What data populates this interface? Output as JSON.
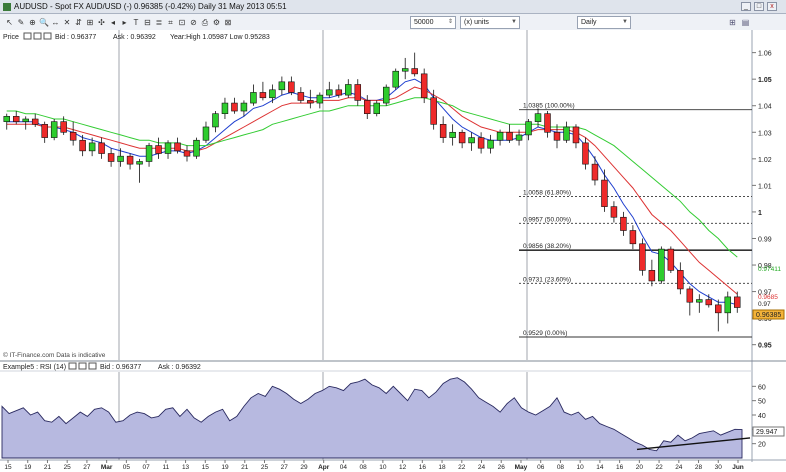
{
  "window": {
    "title": "AUDUSD - Spot FX AUD/USD (-)   0.96385 (-0.42%)   Daily   31 May 2013 05:51",
    "min_label": "_",
    "max_label": "□",
    "close_label": "x"
  },
  "toolbar": {
    "tools": [
      "↖",
      "✎",
      "⊕",
      "🔍",
      "↔",
      "✕",
      "⇵",
      "⊞",
      "✣",
      "◂",
      "▸",
      "T",
      "⊟",
      "≣",
      "⌗",
      "⊡",
      "⊘",
      "⎙",
      "⚙",
      "⊠"
    ],
    "units_value": "50000",
    "units_label": "(x) units",
    "period_value": "Daily"
  },
  "price_panel": {
    "header": "Price",
    "bid": "Bid : 0.96377",
    "ask": "Ask : 0.96392",
    "stats": "Year:High 1.05987 Low 0.95283",
    "source": "© IT-Finance.com   Data is indicative",
    "current_label": "0.96385",
    "ma_labels": [
      {
        "text": "0.97411",
        "color": "#22aa22"
      },
      {
        "text": "0.9685",
        "color": "#dd3333"
      },
      {
        "text": "0.97",
        "color": "#222222"
      }
    ]
  },
  "rsi_panel": {
    "header": "Example5 : RSI (14)",
    "bid": "Bid : 0.96377",
    "ask": "Ask : 0.96392",
    "current_label": "29.947"
  },
  "chart_data": {
    "type": "candlestick",
    "ylim": [
      0.948,
      1.064
    ],
    "y_ticks": [
      "1.06",
      "1.05",
      "1.04",
      "1.03",
      "1.02",
      "1.01",
      "1",
      "0.99",
      "0.98",
      "0.97",
      "0.96",
      "0.95"
    ],
    "y_tick_values": [
      1.06,
      1.05,
      1.04,
      1.03,
      1.02,
      1.01,
      1.0,
      0.99,
      0.98,
      0.97,
      0.96,
      0.95
    ],
    "x_ticks": [
      "15",
      "19",
      "21",
      "25",
      "27",
      "Mar",
      "05",
      "07",
      "11",
      "13",
      "15",
      "19",
      "21",
      "25",
      "27",
      "29",
      "Apr",
      "04",
      "08",
      "10",
      "12",
      "16",
      "18",
      "22",
      "24",
      "26",
      "May",
      "06",
      "08",
      "10",
      "14",
      "16",
      "20",
      "22",
      "24",
      "28",
      "30",
      "Jun"
    ],
    "candles": [
      [
        1.034,
        1.037,
        1.031,
        1.036
      ],
      [
        1.036,
        1.038,
        1.033,
        1.034
      ],
      [
        1.034,
        1.036,
        1.031,
        1.035
      ],
      [
        1.035,
        1.037,
        1.032,
        1.033
      ],
      [
        1.033,
        1.034,
        1.026,
        1.028
      ],
      [
        1.028,
        1.035,
        1.027,
        1.034
      ],
      [
        1.034,
        1.036,
        1.029,
        1.03
      ],
      [
        1.03,
        1.034,
        1.025,
        1.027
      ],
      [
        1.027,
        1.029,
        1.021,
        1.023
      ],
      [
        1.023,
        1.028,
        1.021,
        1.026
      ],
      [
        1.026,
        1.028,
        1.02,
        1.022
      ],
      [
        1.022,
        1.024,
        1.017,
        1.019
      ],
      [
        1.019,
        1.024,
        1.017,
        1.021
      ],
      [
        1.021,
        1.022,
        1.016,
        1.018
      ],
      [
        1.018,
        1.02,
        1.011,
        1.019
      ],
      [
        1.019,
        1.026,
        1.017,
        1.025
      ],
      [
        1.025,
        1.028,
        1.02,
        1.022
      ],
      [
        1.022,
        1.027,
        1.02,
        1.026
      ],
      [
        1.026,
        1.028,
        1.022,
        1.023
      ],
      [
        1.023,
        1.025,
        1.019,
        1.021
      ],
      [
        1.021,
        1.028,
        1.02,
        1.027
      ],
      [
        1.027,
        1.034,
        1.026,
        1.032
      ],
      [
        1.032,
        1.038,
        1.03,
        1.037
      ],
      [
        1.037,
        1.043,
        1.035,
        1.041
      ],
      [
        1.041,
        1.043,
        1.037,
        1.038
      ],
      [
        1.038,
        1.042,
        1.036,
        1.041
      ],
      [
        1.041,
        1.048,
        1.04,
        1.045
      ],
      [
        1.045,
        1.049,
        1.042,
        1.043
      ],
      [
        1.043,
        1.048,
        1.041,
        1.046
      ],
      [
        1.046,
        1.051,
        1.044,
        1.049
      ],
      [
        1.049,
        1.051,
        1.044,
        1.045
      ],
      [
        1.045,
        1.047,
        1.041,
        1.042
      ],
      [
        1.042,
        1.046,
        1.039,
        1.041
      ],
      [
        1.041,
        1.045,
        1.039,
        1.044
      ],
      [
        1.044,
        1.049,
        1.043,
        1.046
      ],
      [
        1.046,
        1.048,
        1.043,
        1.044
      ],
      [
        1.044,
        1.05,
        1.043,
        1.048
      ],
      [
        1.048,
        1.05,
        1.04,
        1.042
      ],
      [
        1.042,
        1.044,
        1.035,
        1.037
      ],
      [
        1.037,
        1.042,
        1.036,
        1.041
      ],
      [
        1.041,
        1.048,
        1.04,
        1.047
      ],
      [
        1.047,
        1.054,
        1.046,
        1.053
      ],
      [
        1.053,
        1.058,
        1.05,
        1.054
      ],
      [
        1.054,
        1.06,
        1.051,
        1.052
      ],
      [
        1.052,
        1.054,
        1.041,
        1.043
      ],
      [
        1.043,
        1.046,
        1.031,
        1.033
      ],
      [
        1.033,
        1.036,
        1.026,
        1.028
      ],
      [
        1.028,
        1.033,
        1.025,
        1.03
      ],
      [
        1.03,
        1.031,
        1.024,
        1.026
      ],
      [
        1.026,
        1.03,
        1.023,
        1.028
      ],
      [
        1.028,
        1.03,
        1.022,
        1.024
      ],
      [
        1.024,
        1.029,
        1.022,
        1.027
      ],
      [
        1.027,
        1.031,
        1.025,
        1.03
      ],
      [
        1.03,
        1.033,
        1.026,
        1.027
      ],
      [
        1.027,
        1.031,
        1.025,
        1.029
      ],
      [
        1.029,
        1.035,
        1.027,
        1.034
      ],
      [
        1.034,
        1.039,
        1.032,
        1.037
      ],
      [
        1.037,
        1.038,
        1.028,
        1.03
      ],
      [
        1.03,
        1.033,
        1.024,
        1.027
      ],
      [
        1.027,
        1.034,
        1.026,
        1.032
      ],
      [
        1.032,
        1.033,
        1.024,
        1.026
      ],
      [
        1.026,
        1.028,
        1.016,
        1.018
      ],
      [
        1.018,
        1.021,
        1.01,
        1.012
      ],
      [
        1.012,
        1.016,
        1.0,
        1.002
      ],
      [
        1.002,
        1.004,
        0.996,
        0.998
      ],
      [
        0.998,
        1.0,
        0.991,
        0.993
      ],
      [
        0.993,
        0.995,
        0.986,
        0.988
      ],
      [
        0.988,
        0.99,
        0.976,
        0.978
      ],
      [
        0.978,
        0.982,
        0.972,
        0.974
      ],
      [
        0.974,
        0.987,
        0.973,
        0.986
      ],
      [
        0.986,
        0.987,
        0.977,
        0.978
      ],
      [
        0.978,
        0.981,
        0.969,
        0.971
      ],
      [
        0.971,
        0.972,
        0.961,
        0.966
      ],
      [
        0.966,
        0.969,
        0.962,
        0.967
      ],
      [
        0.967,
        0.969,
        0.964,
        0.965
      ],
      [
        0.965,
        0.967,
        0.955,
        0.962
      ],
      [
        0.962,
        0.97,
        0.958,
        0.968
      ],
      [
        0.968,
        0.97,
        0.962,
        0.964
      ]
    ],
    "series": [
      {
        "name": "",
        "color": "#1f3fcf",
        "values": [
          1.034,
          1.034,
          1.034,
          1.034,
          1.032,
          1.032,
          1.031,
          1.03,
          1.028,
          1.027,
          1.026,
          1.024,
          1.023,
          1.022,
          1.021,
          1.021,
          1.022,
          1.023,
          1.023,
          1.022,
          1.023,
          1.025,
          1.028,
          1.031,
          1.034,
          1.036,
          1.039,
          1.04,
          1.042,
          1.044,
          1.045,
          1.044,
          1.043,
          1.043,
          1.043,
          1.044,
          1.045,
          1.044,
          1.042,
          1.042,
          1.043,
          1.046,
          1.049,
          1.05,
          1.048,
          1.043,
          1.039,
          1.035,
          1.032,
          1.03,
          1.028,
          1.027,
          1.027,
          1.027,
          1.028,
          1.03,
          1.032,
          1.031,
          1.03,
          1.03,
          1.029,
          1.025,
          1.02,
          1.014,
          1.009,
          1.003,
          0.998,
          0.991,
          0.985,
          0.984,
          0.981,
          0.977,
          0.973,
          0.97,
          0.968,
          0.966,
          0.966,
          0.965
        ]
      },
      {
        "name": "",
        "color": "#dd3333",
        "values": [
          1.033,
          1.033,
          1.033,
          1.033,
          1.032,
          1.032,
          1.032,
          1.031,
          1.03,
          1.029,
          1.028,
          1.027,
          1.026,
          1.025,
          1.024,
          1.024,
          1.024,
          1.024,
          1.024,
          1.023,
          1.023,
          1.024,
          1.026,
          1.028,
          1.03,
          1.032,
          1.034,
          1.036,
          1.038,
          1.04,
          1.041,
          1.041,
          1.041,
          1.042,
          1.042,
          1.042,
          1.043,
          1.043,
          1.042,
          1.042,
          1.042,
          1.043,
          1.045,
          1.047,
          1.046,
          1.044,
          1.042,
          1.039,
          1.036,
          1.034,
          1.032,
          1.031,
          1.03,
          1.03,
          1.03,
          1.03,
          1.031,
          1.031,
          1.031,
          1.031,
          1.03,
          1.028,
          1.025,
          1.021,
          1.017,
          1.013,
          1.009,
          1.004,
          0.999,
          0.996,
          0.993,
          0.989,
          0.985,
          0.981,
          0.978,
          0.975,
          0.972,
          0.969
        ]
      },
      {
        "name": "",
        "color": "#33cc33",
        "values": [
          1.038,
          1.038,
          1.037,
          1.037,
          1.036,
          1.035,
          1.035,
          1.034,
          1.033,
          1.032,
          1.031,
          1.03,
          1.029,
          1.028,
          1.027,
          1.027,
          1.026,
          1.026,
          1.026,
          1.025,
          1.025,
          1.025,
          1.026,
          1.027,
          1.028,
          1.029,
          1.03,
          1.031,
          1.033,
          1.034,
          1.035,
          1.036,
          1.037,
          1.038,
          1.038,
          1.039,
          1.04,
          1.04,
          1.04,
          1.04,
          1.04,
          1.041,
          1.042,
          1.043,
          1.043,
          1.042,
          1.041,
          1.04,
          1.038,
          1.037,
          1.036,
          1.035,
          1.034,
          1.033,
          1.033,
          1.033,
          1.033,
          1.032,
          1.032,
          1.032,
          1.032,
          1.031,
          1.029,
          1.027,
          1.025,
          1.022,
          1.019,
          1.016,
          1.013,
          1.01,
          1.007,
          1.004,
          1.0,
          0.997,
          0.993,
          0.99,
          0.986,
          0.983
        ]
      }
    ],
    "fibonacci": [
      {
        "label": "1.0385 (100.00%)",
        "value": 1.0385,
        "style": "solid"
      },
      {
        "label": "1.0058 (61.80%)",
        "value": 1.0058,
        "style": "dotted"
      },
      {
        "label": "0.9957 (50.00%)",
        "value": 0.9957,
        "style": "dotted"
      },
      {
        "label": "0.9856 (38.20%)",
        "value": 0.9856,
        "style": "bold"
      },
      {
        "label": "0.9731 (23.60%)",
        "value": 0.9731,
        "style": "dotted"
      },
      {
        "label": "0.9529 (0.00%)",
        "value": 0.9529,
        "style": "solid"
      }
    ],
    "rsi": {
      "ylim": [
        10,
        70
      ],
      "y_ticks": [
        "60",
        "50",
        "40",
        "30",
        "20"
      ],
      "y_tick_values": [
        60,
        50,
        40,
        30,
        20
      ],
      "values": [
        46,
        41,
        43,
        45,
        40,
        42,
        36,
        35,
        39,
        34,
        38,
        42,
        39,
        44,
        45,
        42,
        35,
        36,
        40,
        42,
        41,
        38,
        39,
        44,
        45,
        39,
        44,
        38,
        35,
        39,
        42,
        44,
        36,
        39,
        46,
        52,
        55,
        53,
        60,
        58,
        55,
        51,
        48,
        51,
        55,
        57,
        60,
        59,
        57,
        62,
        63,
        65,
        61,
        59,
        55,
        60,
        55,
        50,
        58,
        57,
        52,
        56,
        62,
        65,
        66,
        63,
        58,
        52,
        49,
        46,
        42,
        48,
        52,
        45,
        42,
        40,
        43,
        46,
        52,
        42,
        40,
        42,
        37,
        39,
        34,
        32,
        30,
        27,
        24,
        21,
        19,
        16,
        15,
        22,
        21,
        26,
        22,
        24,
        27,
        28,
        29,
        26,
        28,
        30,
        29.9
      ]
    }
  }
}
